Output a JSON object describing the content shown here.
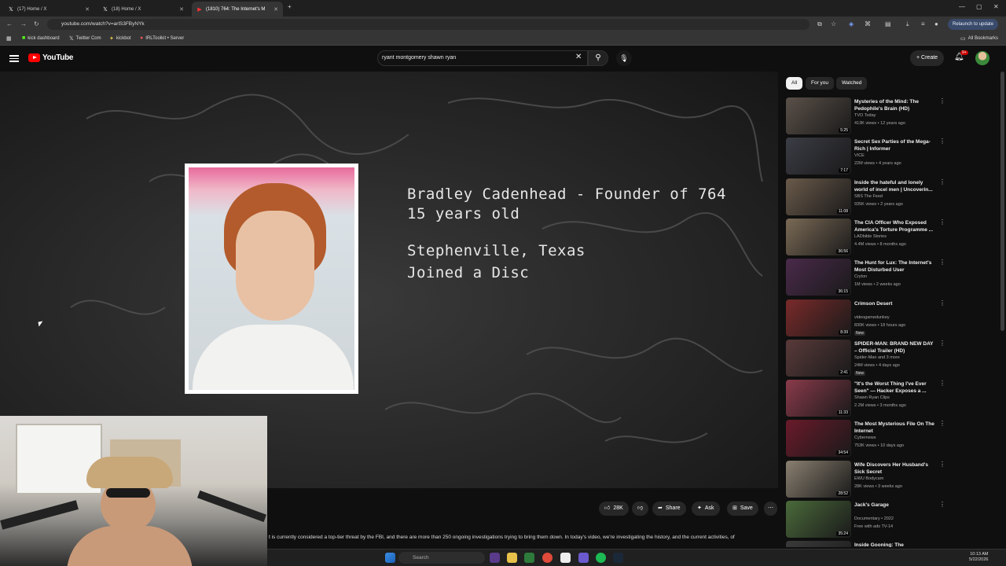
{
  "tabs": [
    {
      "label": "(17) Home / X",
      "icon": "x-logo-icon"
    },
    {
      "label": "(18) Home / X",
      "icon": "x-logo-icon"
    },
    {
      "label": "(1810) 764: The Internet's M",
      "icon": "youtube-icon",
      "active": true
    }
  ],
  "address": {
    "url": "youtube.com/watch?v=arlS3FByNYk",
    "relaunch_label": "Relaunch to update"
  },
  "bookmarks": [
    "kick dashboard",
    "Twitter Com",
    "kickbot",
    "IRLToolkit • Server"
  ],
  "all_bookmarks_label": "All Bookmarks",
  "youtube": {
    "logo_text": "YouTube",
    "search_query": "ryant montgomery shawn ryan",
    "create_label": "Create",
    "notif_count": "9+"
  },
  "video": {
    "line1": "Bradley Cadenhead - Founder of 764",
    "line2": "15 years old",
    "line3": "Stephenville, Texas",
    "line4": "Joined a Disc"
  },
  "actions": {
    "like_count": "28K",
    "share_label": "Share",
    "ask_label": "Ask",
    "save_label": "Save"
  },
  "description_snippet": "t is currently considered a top-tier threat by the FBI, and there are more than 250 ongoing investigations trying to bring them down. In today's video, we're investigating the history, and the current activities, of",
  "chips": [
    "All",
    "For you",
    "Watched"
  ],
  "recommendations": [
    {
      "title": "Mysteries of the Mind: The Pedophile's Brain (HD)",
      "channel": "TVO Today",
      "meta": "413K views • 12 years ago",
      "duration": "5:25",
      "thumb": "#5a5048"
    },
    {
      "title": "Secret Sex Parties of the Mega-Rich | Informer",
      "channel": "VICE",
      "meta": "22M views • 4 years ago",
      "duration": "7:17",
      "thumb": "#3b3d45"
    },
    {
      "title": "Inside the hateful and lonely world of incel men | Uncoverin...",
      "channel": "SBS The Feed",
      "meta": "935K views • 2 years ago",
      "duration": "11:08",
      "thumb": "#6a5a4a"
    },
    {
      "title": "The CIA Officer Who Exposed America's Torture Programme ...",
      "channel": "LADbible Stories",
      "meta": "4.4M views • 8 months ago",
      "duration": "36:56",
      "thumb": "#7a6a55"
    },
    {
      "title": "The Hunt for Lux: The Internet's Most Disturbed User",
      "channel": "Cryton",
      "meta": "1M views • 2 weeks ago",
      "duration": "36:15",
      "thumb": "#4a2a4a"
    },
    {
      "title": "Crimson Desert",
      "channel": "videogamedunkey",
      "meta": "830K views • 18 hours ago",
      "duration": "8:39",
      "thumb": "#7a2a2a",
      "badge": "New"
    },
    {
      "title": "SPIDER-MAN: BRAND NEW DAY – Official Trailer (HD)",
      "channel": "Spider-Man and 3 more",
      "meta": "24M views • 4 days ago",
      "duration": "2:41",
      "thumb": "#5a3a3a",
      "badge": "New"
    },
    {
      "title": "\"It's the Worst Thing I've Ever Seen\" — Hacker Exposes a ...",
      "channel": "Shawn Ryan Clips",
      "meta": "2.2M views • 3 months ago",
      "duration": "11:33",
      "thumb": "#8a3a4a"
    },
    {
      "title": "The Most Mysterious File On The Internet",
      "channel": "Cybernews",
      "meta": "753K views • 10 days ago",
      "duration": "34:54",
      "thumb": "#6a1a2a"
    },
    {
      "title": "Wife Discovers Her Husband's Sick Secret",
      "channel": "EWU Bodycam",
      "meta": "28K views • 3 weeks ago",
      "duration": "28:52",
      "thumb": "#8a8070"
    },
    {
      "title": "Jack's Garage",
      "channel": "Documentary • 2022",
      "meta": "Free with ads  TV-14",
      "duration": "35:24",
      "thumb": "#4a6a3a"
    },
    {
      "title": "Inside Gooning: The",
      "channel": "",
      "meta": "",
      "duration": "",
      "thumb": "#3a3a3a"
    }
  ],
  "taskbar": {
    "search_placeholder": "Search",
    "time": "10:13 AM",
    "date": "5/22/2026"
  }
}
